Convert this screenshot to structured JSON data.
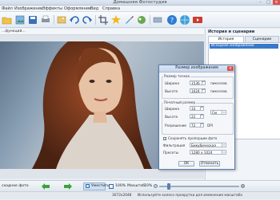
{
  "window": {
    "title": "Домашняя Фотостудия",
    "minimize": "–",
    "maximize": "□",
    "close": "×"
  },
  "menu": [
    "Файл",
    "Изображение",
    "Эффекты",
    "Оформление",
    "Вид",
    "Справка"
  ],
  "toolbar": {
    "icons": [
      "folder-open-icon",
      "gallery-icon",
      "save-icon",
      "print-icon",
      "image-icon",
      "undo-icon",
      "redo-icon",
      "crop-icon",
      "effects-icon",
      "brush-icon",
      "color-icon",
      "help-icon",
      "globe-icon",
      "video-icon"
    ]
  },
  "breadcrumb": "...функций...",
  "right_panel": {
    "title": "История и сценарии",
    "tab_history": "История действий",
    "tab_scenarios": "Сценарии",
    "history_item": "Исходное изображение"
  },
  "dialog": {
    "title": "Размер изображения",
    "close": "×",
    "pixel_size_label": "Размер точках",
    "width_label": "Ширина",
    "width_value": "1536",
    "height_label": "Высота",
    "height_value": "1024",
    "unit_pixels": "пикселов",
    "print_size_label": "Печатный размер",
    "print_width_label": "Ширина",
    "print_width_value": "33",
    "print_height_label": "Высота",
    "print_height_value": "22",
    "resolution_label": "Разрешение",
    "resolution_value": "72",
    "unit_cm": "См",
    "unit_dpi": "DPI",
    "keep_ratio_label": "Сохранять пропорции фото",
    "keep_ratio_checked": true,
    "filter_label": "Фильтрация",
    "filter_value": "Бикубическая",
    "preset_label": "Пресеты",
    "preset_value": "1280 x 1024",
    "ok": "ОК",
    "cancel": "Отменить"
  },
  "bottom": {
    "source_label": "сходное фото",
    "fit_label": "Уместить",
    "zoom_value": "100%",
    "scale_label": "Масштаб:",
    "scale_value": "10%"
  },
  "status": {
    "dimensions": "3072x2048",
    "hint": "Используйте колесо прокрутки для изменения масштаба"
  },
  "colors": {
    "accent": "#3a78c9",
    "dialog_border": "#5a7fae",
    "close_red": "#d9534f"
  }
}
